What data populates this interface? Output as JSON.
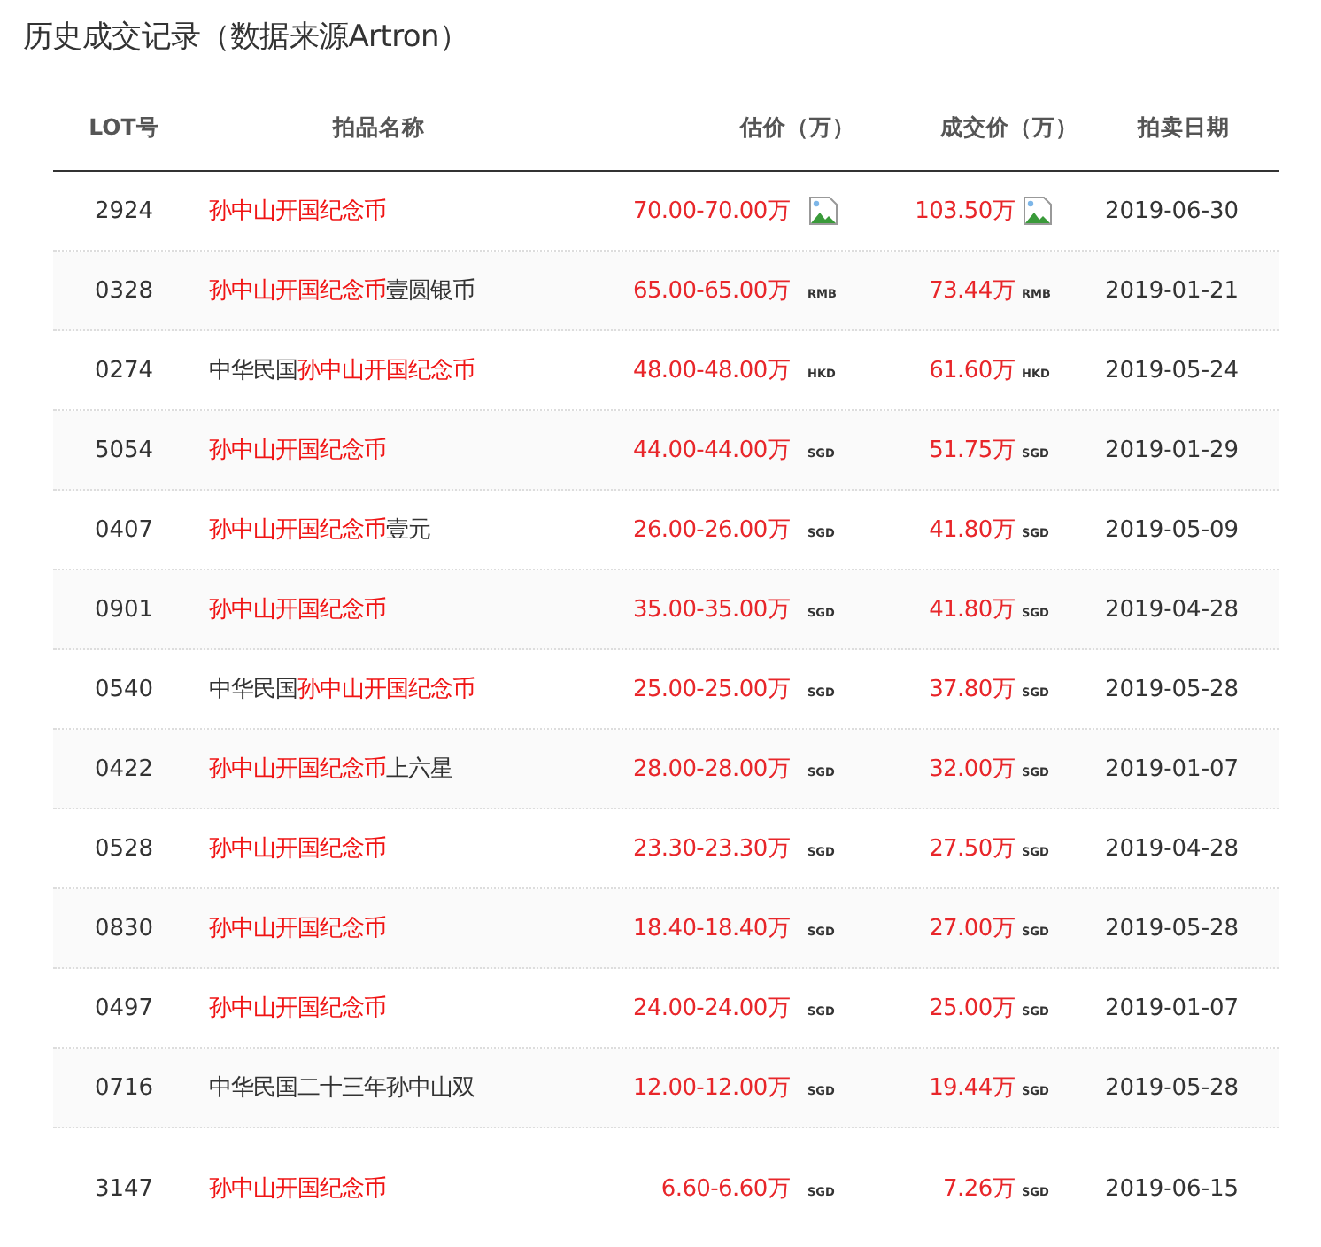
{
  "title": "历史成交记录（数据来源Artron）",
  "columns": [
    "LOT号",
    "拍品名称",
    "估价（万）",
    "成交价（万）",
    "拍卖日期"
  ],
  "rows": [
    {
      "lot": "2924",
      "name": [
        {
          "text": "孙中山开国纪念币",
          "highlight": true
        }
      ],
      "estimate": "70.00-70.00万",
      "estimate_currency": {
        "kind": "broken-image"
      },
      "price": "103.50万",
      "price_currency": {
        "kind": "broken-image"
      },
      "date": "2019-06-30"
    },
    {
      "lot": "0328",
      "name": [
        {
          "text": "孙中山开国纪念币",
          "highlight": true
        },
        {
          "text": "壹圆银币",
          "highlight": false
        }
      ],
      "estimate": "65.00-65.00万",
      "estimate_currency": {
        "kind": "label",
        "text": "RMB"
      },
      "price": "73.44万",
      "price_currency": {
        "kind": "label",
        "text": "RMB"
      },
      "date": "2019-01-21"
    },
    {
      "lot": "0274",
      "name": [
        {
          "text": "中华民国",
          "highlight": false
        },
        {
          "text": "孙中山开国纪念币",
          "highlight": true
        }
      ],
      "estimate": "48.00-48.00万",
      "estimate_currency": {
        "kind": "label",
        "text": "HKD"
      },
      "price": "61.60万",
      "price_currency": {
        "kind": "label",
        "text": "HKD"
      },
      "date": "2019-05-24"
    },
    {
      "lot": "5054",
      "name": [
        {
          "text": "孙中山开国纪念币",
          "highlight": true
        }
      ],
      "estimate": "44.00-44.00万",
      "estimate_currency": {
        "kind": "label",
        "text": "SGD"
      },
      "price": "51.75万",
      "price_currency": {
        "kind": "label",
        "text": "SGD"
      },
      "date": "2019-01-29"
    },
    {
      "lot": "0407",
      "name": [
        {
          "text": "孙中山开国纪念币",
          "highlight": true
        },
        {
          "text": "壹元",
          "highlight": false
        }
      ],
      "estimate": "26.00-26.00万",
      "estimate_currency": {
        "kind": "label",
        "text": "SGD"
      },
      "price": "41.80万",
      "price_currency": {
        "kind": "label",
        "text": "SGD"
      },
      "date": "2019-05-09"
    },
    {
      "lot": "0901",
      "name": [
        {
          "text": "孙中山开国纪念币",
          "highlight": true
        }
      ],
      "estimate": "35.00-35.00万",
      "estimate_currency": {
        "kind": "label",
        "text": "SGD"
      },
      "price": "41.80万",
      "price_currency": {
        "kind": "label",
        "text": "SGD"
      },
      "date": "2019-04-28"
    },
    {
      "lot": "0540",
      "name": [
        {
          "text": "中华民国",
          "highlight": false
        },
        {
          "text": "孙中山开国纪念币",
          "highlight": true
        }
      ],
      "estimate": "25.00-25.00万",
      "estimate_currency": {
        "kind": "label",
        "text": "SGD"
      },
      "price": "37.80万",
      "price_currency": {
        "kind": "label",
        "text": "SGD"
      },
      "date": "2019-05-28"
    },
    {
      "lot": "0422",
      "name": [
        {
          "text": "孙中山开国纪念币",
          "highlight": true
        },
        {
          "text": "上六星",
          "highlight": false
        }
      ],
      "estimate": "28.00-28.00万",
      "estimate_currency": {
        "kind": "label",
        "text": "SGD"
      },
      "price": "32.00万",
      "price_currency": {
        "kind": "label",
        "text": "SGD"
      },
      "date": "2019-01-07"
    },
    {
      "lot": "0528",
      "name": [
        {
          "text": "孙中山开国纪念币",
          "highlight": true
        }
      ],
      "estimate": "23.30-23.30万",
      "estimate_currency": {
        "kind": "label",
        "text": "SGD"
      },
      "price": "27.50万",
      "price_currency": {
        "kind": "label",
        "text": "SGD"
      },
      "date": "2019-04-28"
    },
    {
      "lot": "0830",
      "name": [
        {
          "text": "孙中山开国纪念币",
          "highlight": true
        }
      ],
      "estimate": "18.40-18.40万",
      "estimate_currency": {
        "kind": "label",
        "text": "SGD"
      },
      "price": "27.00万",
      "price_currency": {
        "kind": "label",
        "text": "SGD"
      },
      "date": "2019-05-28"
    },
    {
      "lot": "0497",
      "name": [
        {
          "text": "孙中山开国纪念币",
          "highlight": true
        }
      ],
      "estimate": "24.00-24.00万",
      "estimate_currency": {
        "kind": "label",
        "text": "SGD"
      },
      "price": "25.00万",
      "price_currency": {
        "kind": "label",
        "text": "SGD"
      },
      "date": "2019-01-07"
    },
    {
      "lot": "0716",
      "name": [
        {
          "text": "中华民国二十三年孙中山双",
          "highlight": false
        }
      ],
      "estimate": "12.00-12.00万",
      "estimate_currency": {
        "kind": "label",
        "text": "SGD"
      },
      "price": "19.44万",
      "price_currency": {
        "kind": "label",
        "text": "SGD"
      },
      "date": "2019-05-28"
    },
    {
      "lot": "3147",
      "name": [
        {
          "text": "孙中山开国纪念币",
          "highlight": true
        }
      ],
      "estimate": "6.60-6.60万",
      "estimate_currency": {
        "kind": "label",
        "text": "SGD"
      },
      "price": "7.26万",
      "price_currency": {
        "kind": "label",
        "text": "SGD"
      },
      "date": "2019-06-15"
    }
  ]
}
